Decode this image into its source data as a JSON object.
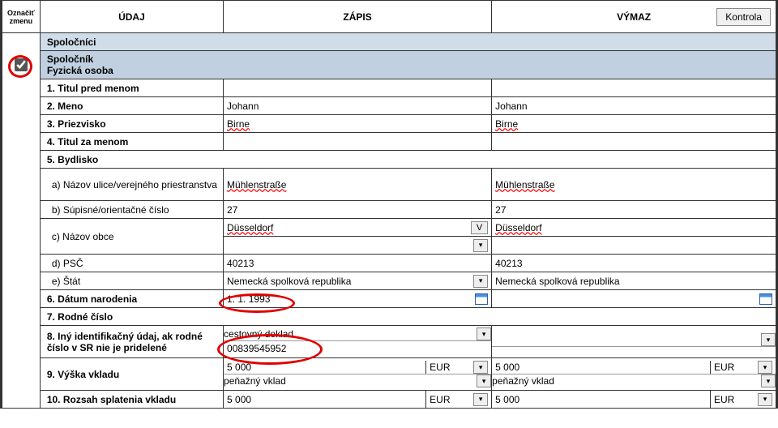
{
  "header": {
    "mark": "Označiť zmenu",
    "udaj": "ÚDAJ",
    "zapis": "ZÁPIS",
    "vymaz": "VÝMAZ",
    "kontrola": "Kontrola"
  },
  "section": {
    "title": "Spoločníci"
  },
  "subsection": {
    "line1": "Spoločník",
    "line2": "Fyzická osoba"
  },
  "rows": {
    "r1": {
      "label": "1. Titul pred menom",
      "zapis": "",
      "vymaz": ""
    },
    "r2": {
      "label": "2. Meno",
      "zapis": "Johann",
      "vymaz": "Johann"
    },
    "r3": {
      "label": "3. Priezvisko",
      "zapis": "Birne",
      "vymaz": "Birne"
    },
    "r4": {
      "label": "4. Titul za menom",
      "zapis": "",
      "vymaz": ""
    },
    "r5": {
      "label": "5. Bydlisko"
    },
    "r5a": {
      "label": "a) Názov ulice/verejného priestranstva",
      "zapis": "Mühlenstraße",
      "vymaz": "Mühlenstraße"
    },
    "r5b": {
      "label": "b) Súpisné/orientačné číslo",
      "zapis": "27",
      "vymaz": "27"
    },
    "r5c": {
      "label": "c) Názov obce",
      "zapis": "Düsseldorf",
      "vymaz": "Düsseldorf",
      "vbtn": "V"
    },
    "r5d": {
      "label": "d) PSČ",
      "zapis": "40213",
      "vymaz": "40213"
    },
    "r5e": {
      "label": "e) Štát",
      "zapis": "Nemecká spolková republika",
      "vymaz": "Nemecká spolková republika"
    },
    "r6": {
      "label": "6. Dátum narodenia",
      "zapis": "1. 1. 1993",
      "vymaz": ""
    },
    "r7": {
      "label": "7. Rodné číslo"
    },
    "r8": {
      "label": "8. Iný identifikačný údaj, ak rodné číslo v SR nie je pridelené",
      "zapis_top": "cestovný doklad",
      "zapis_bot": "00839545952"
    },
    "r9": {
      "label": "9. Výška vkladu",
      "zapis_amt": "5 000",
      "zapis_cur": "EUR",
      "zapis_kind": "peňažný vklad",
      "vymaz_amt": "5 000",
      "vymaz_cur": "EUR",
      "vymaz_kind": "peňažný vklad"
    },
    "r10": {
      "label": "10. Rozsah splatenia vkladu",
      "zapis_amt": "5 000",
      "zapis_cur": "EUR",
      "vymaz_amt": "5 000",
      "vymaz_cur": "EUR"
    }
  }
}
